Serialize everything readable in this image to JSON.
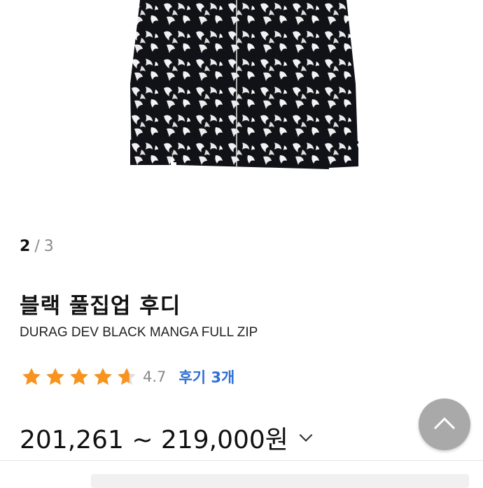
{
  "pager": {
    "current": "2",
    "separator": "/",
    "total": "3"
  },
  "product": {
    "title": "블랙 풀집업 후디",
    "subtitle": "DURAG DEV BLACK MANGA FULL ZIP"
  },
  "rating": {
    "value": "4.7",
    "stars": 4.7,
    "reviews_link": "후기 3개"
  },
  "price": {
    "range": "201,261 ~ 219,000원"
  },
  "colors": {
    "star": "#f7931e",
    "link": "#2d6fd6",
    "fab": "#a9a9a9"
  },
  "icons": [
    "star-icon",
    "chevron-down-icon",
    "chevron-up-icon"
  ]
}
